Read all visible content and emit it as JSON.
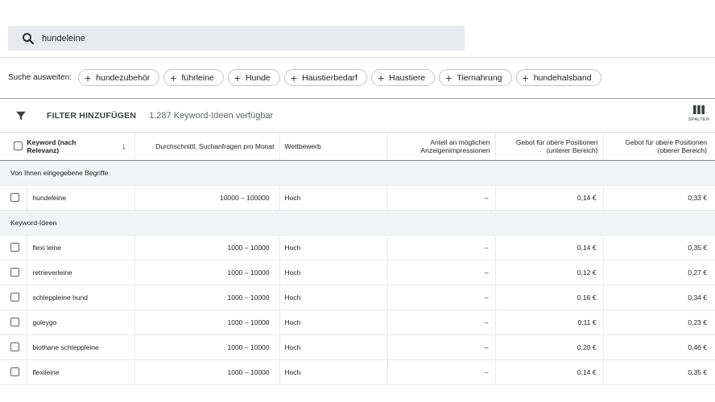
{
  "search": {
    "value": "hundeleine"
  },
  "expand": {
    "label": "Suche ausweiten:",
    "chips": [
      "hundezubehör",
      "führleine",
      "Hunde",
      "Haustierbedarf",
      "Haustiere",
      "Tiernahrung",
      "hundehalsband"
    ]
  },
  "toolbar": {
    "filter_label": "FILTER HINZUFÜGEN",
    "count_text": "1.287 Keyword-Ideen verfügbar",
    "columns_label": "SPALTEN"
  },
  "table": {
    "headers": {
      "keyword": "Keyword (nach Relevanz)",
      "searches": "Durchschnittl. Suchanfragen pro Monat",
      "competition": "Wettbewerb",
      "impression_share": "Anteil an möglichen Anzeigenimpressionen",
      "bid_low": "Gebot für obere Positionen (unterer Bereich)",
      "bid_high": "Gebot für obere Positionen (oberer Bereich)"
    },
    "groups": [
      {
        "title": "Von Ihnen eingegebene Begriffe",
        "rows": [
          {
            "keyword": "hundeleine",
            "searches": "10000 – 100000",
            "competition": "Hoch",
            "impression_share": "–",
            "bid_low": "0,14 €",
            "bid_high": "0,33 €"
          }
        ]
      },
      {
        "title": "Keyword-Ideen",
        "rows": [
          {
            "keyword": "flexi leine",
            "searches": "1000 – 10000",
            "competition": "Hoch",
            "impression_share": "–",
            "bid_low": "0,14 €",
            "bid_high": "0,35 €"
          },
          {
            "keyword": "retrieverleine",
            "searches": "1000 – 10000",
            "competition": "Hoch",
            "impression_share": "–",
            "bid_low": "0,12 €",
            "bid_high": "0,27 €"
          },
          {
            "keyword": "schleppleine hund",
            "searches": "1000 – 10000",
            "competition": "Hoch",
            "impression_share": "–",
            "bid_low": "0,16 €",
            "bid_high": "0,34 €"
          },
          {
            "keyword": "goleygo",
            "searches": "1000 – 10000",
            "competition": "Hoch",
            "impression_share": "–",
            "bid_low": "0,11 €",
            "bid_high": "0,23 €"
          },
          {
            "keyword": "biothane schleppleine",
            "searches": "1000 – 10000",
            "competition": "Hoch",
            "impression_share": "–",
            "bid_low": "0,20 €",
            "bid_high": "0,46 €"
          },
          {
            "keyword": "flexileine",
            "searches": "1000 – 10000",
            "competition": "Hoch",
            "impression_share": "–",
            "bid_low": "0,14 €",
            "bid_high": "0,35 €"
          }
        ]
      }
    ]
  }
}
